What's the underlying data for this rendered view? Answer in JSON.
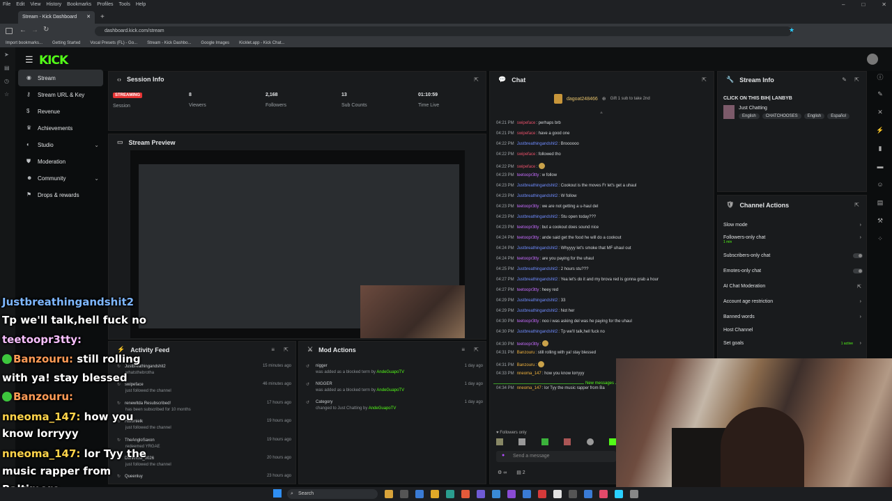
{
  "browser": {
    "menu": [
      "File",
      "Edit",
      "View",
      "History",
      "Bookmarks",
      "Profiles",
      "Tools",
      "Help"
    ],
    "tab_title": "Stream - Kick Dashboard",
    "url": "dashboard.kick.com/stream",
    "bookmarks": [
      "Import bookmarks...",
      "Getting Started",
      "Vocal Presets (FL) - Go...",
      "Stream - Kick Dashbo...",
      "Google Images",
      "Kicklet.app - Kick Chat..."
    ]
  },
  "kick": {
    "logo": "KICK",
    "sidebar": [
      {
        "label": "Stream",
        "icon": "broadcast-icon"
      },
      {
        "label": "Stream URL & Key",
        "icon": "key-icon"
      },
      {
        "label": "Revenue",
        "icon": "dollar-icon"
      },
      {
        "label": "Achievements",
        "icon": "trophy-icon"
      },
      {
        "label": "Studio",
        "icon": "palette-icon"
      },
      {
        "label": "Moderation",
        "icon": "shield-icon"
      },
      {
        "label": "Community",
        "icon": "users-icon"
      },
      {
        "label": "Drops & rewards",
        "icon": "gift-icon"
      }
    ],
    "session": {
      "title": "Session Info",
      "status": "STREAMING",
      "stats": [
        {
          "value": "",
          "label": "Session"
        },
        {
          "value": "8",
          "label": "Viewers"
        },
        {
          "value": "2,168",
          "label": "Followers"
        },
        {
          "value": "13",
          "label": "Sub Counts"
        },
        {
          "value": "01:10:59",
          "label": "Time Live"
        }
      ]
    },
    "preview_title": "Stream Preview",
    "activity": {
      "title": "Activity Feed",
      "rows": [
        {
          "name": "Justbreathingandshit2",
          "extra": "whatsthebrotha",
          "sub": "",
          "time": "15 minutes ago"
        },
        {
          "name": "swipeface",
          "extra": "",
          "sub": "just followed the channel",
          "time": "46 minutes ago"
        },
        {
          "name": "renewltda Resubscribed!",
          "extra": "",
          "sub": "has been subscribed for 10 months",
          "time": "17 hours ago"
        },
        {
          "name": "Hakimielk",
          "extra": "",
          "sub": "just followed the channel",
          "time": "19 hours ago"
        },
        {
          "name": "TheAngloSaxon",
          "extra": "",
          "sub": "redeemed YRGAE",
          "time": "19 hours ago"
        },
        {
          "name": "Dankhost_0026",
          "extra": "",
          "sub": "just followed the channel",
          "time": "20 hours ago"
        },
        {
          "name": "Queenluy",
          "extra": "",
          "sub": "",
          "time": "23 hours ago"
        }
      ]
    },
    "mod": {
      "title": "Mod Actions",
      "rows": [
        {
          "name": "nigger",
          "sub": "was added as a blocked term by",
          "by": "AndeGuapoTV",
          "time": "1 day ago"
        },
        {
          "name": "NIGGER",
          "sub": "was added as a blocked term by",
          "by": "AndeGuapoTV",
          "time": "1 day ago"
        },
        {
          "name": "Category",
          "sub": "changed to Just Chatting by",
          "by": "AndeGuapoTV",
          "time": "1 day ago"
        }
      ]
    },
    "chat": {
      "title": "Chat",
      "pinned_user": "dagoat248466",
      "gift_label": "Gift 1 sub to take 2nd",
      "messages": [
        {
          "time": "04:21 PM",
          "user": "swipeface",
          "color": "#e8506a",
          "text": "perhaps brb"
        },
        {
          "time": "04:21 PM",
          "user": "swipeface",
          "color": "#e8506a",
          "text": "have a good one"
        },
        {
          "time": "04:22 PM",
          "user": "Justbreathingandshit2",
          "color": "#6f8cff",
          "text": "Broooooo"
        },
        {
          "time": "04:22 PM",
          "user": "swipeface",
          "color": "#e8506a",
          "text": "followed tho"
        },
        {
          "time": "04:22 PM",
          "user": "swipeface",
          "color": "#e8506a",
          "text": ""
        },
        {
          "time": "04:23 PM",
          "user": "teetoopr3tty",
          "color": "#c76cff",
          "text": "w follow"
        },
        {
          "time": "04:23 PM",
          "user": "Justbreathingandshit2",
          "color": "#6f8cff",
          "text": "Cookout is the moves Fr let's get a uhaul"
        },
        {
          "time": "04:23 PM",
          "user": "Justbreathingandshit2",
          "color": "#6f8cff",
          "text": "W follow"
        },
        {
          "time": "04:23 PM",
          "user": "teetoopr3tty",
          "color": "#c76cff",
          "text": "we are not getting a u-haul del"
        },
        {
          "time": "04:23 PM",
          "user": "Justbreathingandshit2",
          "color": "#6f8cff",
          "text": "Stu open today???"
        },
        {
          "time": "04:23 PM",
          "user": "teetoopr3tty",
          "color": "#c76cff",
          "text": "but a cookout does sound nice"
        },
        {
          "time": "04:24 PM",
          "user": "teetoopr3tty",
          "color": "#c76cff",
          "text": "ande said get the food he will do a cookout"
        },
        {
          "time": "04:24 PM",
          "user": "Justbreathingandshit2",
          "color": "#6f8cff",
          "text": "Whyyyy let's smoke that MF uhaul out"
        },
        {
          "time": "04:24 PM",
          "user": "teetoopr3tty",
          "color": "#c76cff",
          "text": "are you paying for the uhaul"
        },
        {
          "time": "04:25 PM",
          "user": "Justbreathingandshit2",
          "color": "#6f8cff",
          "text": "2 hours stu???"
        },
        {
          "time": "04:27 PM",
          "user": "Justbreathingandshit2",
          "color": "#6f8cff",
          "text": "Yea let's do it and my brova red is gonna grab a hour"
        },
        {
          "time": "04:27 PM",
          "user": "teetoopr3tty",
          "color": "#c76cff",
          "text": "heey red"
        },
        {
          "time": "04:29 PM",
          "user": "Justbreathingandshit2",
          "color": "#6f8cff",
          "text": "33"
        },
        {
          "time": "04:29 PM",
          "user": "Justbreathingandshit2",
          "color": "#6f8cff",
          "text": "Not her"
        },
        {
          "time": "04:30 PM",
          "user": "teetoopr3tty",
          "color": "#c76cff",
          "text": "noo i was asking del was he paying for the uhaul"
        },
        {
          "time": "04:30 PM",
          "user": "Justbreathingandshit2",
          "color": "#6f8cff",
          "text": "Tp we'll talk,hell fuck no"
        },
        {
          "time": "04:30 PM",
          "user": "teetoopr3tty",
          "color": "#c76cff",
          "text": ""
        },
        {
          "time": "04:31 PM",
          "user": "Banzouru",
          "color": "#f2b33d",
          "text": "still rolling with ya! stay blessed"
        },
        {
          "time": "04:31 PM",
          "user": "Banzouru",
          "color": "#f2b33d",
          "text": ""
        },
        {
          "time": "04:33 PM",
          "user": "nneoma_147",
          "color": "#f2b33d",
          "text": "how you know lorryyy"
        },
        {
          "time": "04:34 PM",
          "user": "nneoma_147",
          "color": "#f2b33d",
          "text": "lor Tyy the music rapper from Ba"
        }
      ],
      "new_messages": "New messages",
      "followers_only": "Followers only",
      "placeholder": "Send a message",
      "viewer_count": "2"
    },
    "stream_info": {
      "title": "Stream Info",
      "stream_title": "CLICK ON THIS BIH| LANBYB",
      "category": "Just Chatting",
      "tags": [
        "English",
        "CHATCHOOSES",
        "English",
        "Español"
      ]
    },
    "channel_actions": {
      "title": "Channel Actions",
      "rows": [
        {
          "label": "Slow mode",
          "type": "chev",
          "sub": ""
        },
        {
          "label": "Followers-only chat",
          "type": "chev",
          "sub": "1 min"
        },
        {
          "label": "Subscribers-only chat",
          "type": "toggle",
          "sub": ""
        },
        {
          "label": "Emotes-only chat",
          "type": "toggle",
          "sub": ""
        },
        {
          "label": "AI Chat Moderation",
          "type": "ext",
          "sub": ""
        },
        {
          "label": "Account age restriction",
          "type": "chev",
          "sub": ""
        },
        {
          "label": "Banned words",
          "type": "chev",
          "sub": ""
        },
        {
          "label": "Host Channel",
          "type": "none",
          "sub": ""
        },
        {
          "label": "Set goals",
          "type": "chev",
          "sub": "1 active"
        }
      ]
    }
  },
  "overlay": [
    {
      "user": "Justbreathingandshit2",
      "text": "",
      "cls": "n1",
      "check": false
    },
    {
      "user": "",
      "text": "Tp we'll talk,hell fuck no",
      "cls": "",
      "check": false
    },
    {
      "user": "teetoopr3tty:",
      "text": "",
      "cls": "n2",
      "check": false
    },
    {
      "user": "Banzouru:",
      "text": "still rolling",
      "cls": "n3",
      "check": true
    },
    {
      "user": "",
      "text": "with ya! stay blessed",
      "cls": "",
      "check": false
    },
    {
      "user": "Banzouru:",
      "text": "",
      "cls": "n3",
      "check": true
    },
    {
      "user": "nneoma_147:",
      "text": "how you",
      "cls": "n4",
      "check": false
    },
    {
      "user": "",
      "text": "know lorryyy",
      "cls": "",
      "check": false
    },
    {
      "user": "nneoma_147:",
      "text": "lor Tyy the",
      "cls": "n4",
      "check": false
    },
    {
      "user": "",
      "text": "music rapper from",
      "cls": "",
      "check": false
    },
    {
      "user": "",
      "text": "Baltimore",
      "cls": "",
      "check": false
    }
  ],
  "taskbar": {
    "search": "Search"
  }
}
